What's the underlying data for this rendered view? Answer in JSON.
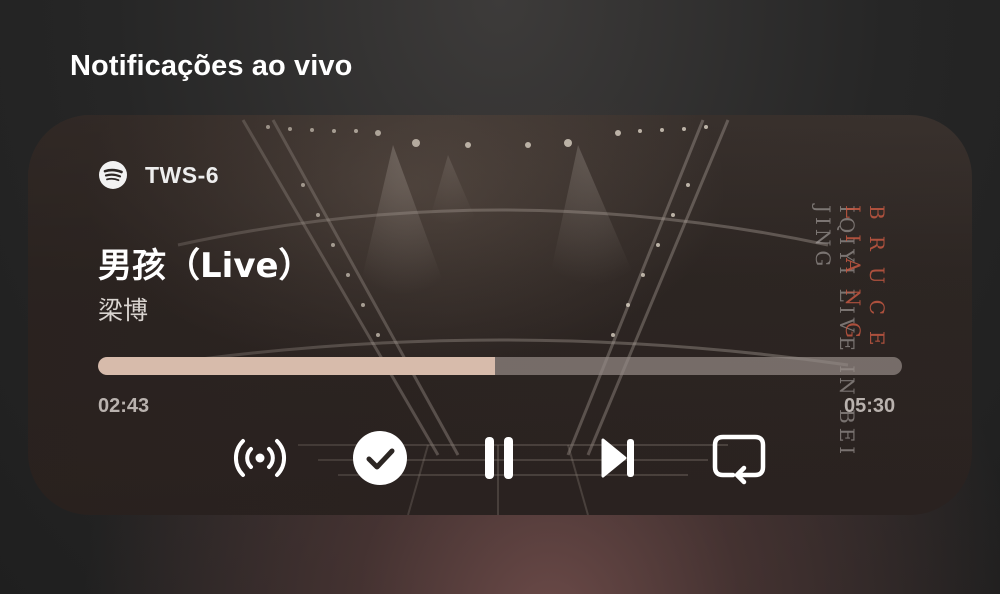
{
  "header": {
    "title": "Notificações ao vivo"
  },
  "notification": {
    "app_icon": "spotify-icon",
    "app_name": "TWS-6",
    "song_title": "男孩（Live）",
    "artist": "梁博",
    "album_art": {
      "vertical_text_1": "IQIYI LIVE IN BEI JING",
      "vertical_text_2": "BRUCE LIANG"
    },
    "progress": {
      "elapsed": "02:43",
      "duration": "05:30",
      "fraction": 0.494
    },
    "controls": [
      {
        "name": "cast-button",
        "icon": "broadcast-icon"
      },
      {
        "name": "save-button",
        "icon": "check-circle-icon"
      },
      {
        "name": "pause-button",
        "icon": "pause-icon"
      },
      {
        "name": "next-button",
        "icon": "skip-next-icon"
      },
      {
        "name": "repeat-button",
        "icon": "repeat-icon"
      }
    ]
  },
  "colors": {
    "progress_fill": "#d7bbab",
    "progress_track": "#968c88",
    "accent_red": "#c45842"
  }
}
